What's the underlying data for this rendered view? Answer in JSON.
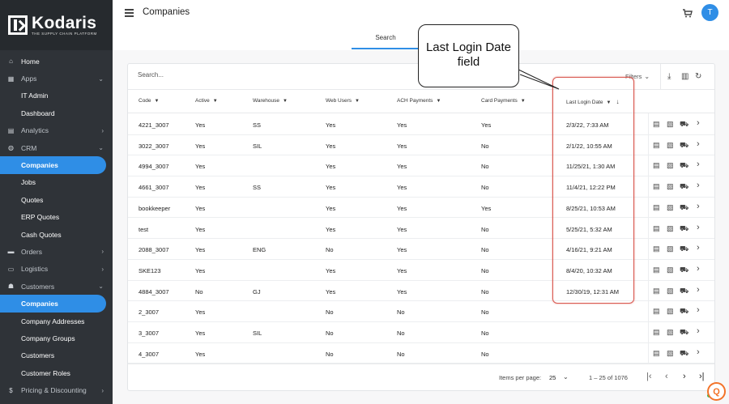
{
  "brand": {
    "name": "Kodaris",
    "tagline": "THE SUPPLY CHAIN PLATFORM"
  },
  "sidebar": {
    "items": [
      {
        "label": "Home",
        "icon": "home-icon",
        "kind": "top",
        "chevron": ""
      },
      {
        "label": "Apps",
        "icon": "grid-icon",
        "kind": "top",
        "chevron": "⌄"
      },
      {
        "label": "IT Admin",
        "icon": "",
        "kind": "sub",
        "chevron": ""
      },
      {
        "label": "Dashboard",
        "icon": "",
        "kind": "sub",
        "chevron": ""
      },
      {
        "label": "Analytics",
        "icon": "chart-icon",
        "kind": "top",
        "chevron": "›"
      },
      {
        "label": "CRM",
        "icon": "crm-icon",
        "kind": "top",
        "chevron": "⌄"
      },
      {
        "label": "Companies",
        "icon": "",
        "kind": "sub active",
        "chevron": ""
      },
      {
        "label": "Jobs",
        "icon": "",
        "kind": "sub",
        "chevron": ""
      },
      {
        "label": "Quotes",
        "icon": "",
        "kind": "sub",
        "chevron": ""
      },
      {
        "label": "ERP Quotes",
        "icon": "",
        "kind": "sub",
        "chevron": ""
      },
      {
        "label": "Cash Quotes",
        "icon": "",
        "kind": "sub",
        "chevron": ""
      },
      {
        "label": "Orders",
        "icon": "truck-icon",
        "kind": "top",
        "chevron": "›"
      },
      {
        "label": "Logistics",
        "icon": "box-icon",
        "kind": "top",
        "chevron": "›"
      },
      {
        "label": "Customers",
        "icon": "people-icon",
        "kind": "top",
        "chevron": "⌄"
      },
      {
        "label": "Companies",
        "icon": "",
        "kind": "sub active",
        "chevron": ""
      },
      {
        "label": "Company Addresses",
        "icon": "",
        "kind": "sub",
        "chevron": ""
      },
      {
        "label": "Company Groups",
        "icon": "",
        "kind": "sub",
        "chevron": ""
      },
      {
        "label": "Customers",
        "icon": "",
        "kind": "sub",
        "chevron": ""
      },
      {
        "label": "Customer Roles",
        "icon": "",
        "kind": "sub",
        "chevron": ""
      },
      {
        "label": "Pricing & Discounting",
        "icon": "dollar-icon",
        "kind": "top",
        "chevron": "›"
      }
    ]
  },
  "header": {
    "title": "Companies",
    "avatar_initial": "T",
    "tab": "Search"
  },
  "toolbar": {
    "search_placeholder": "Search...",
    "filters_label": "Filters"
  },
  "table": {
    "columns": [
      "Code",
      "Active",
      "Warehouse",
      "Web Users",
      "ACH Payments",
      "Card Payments",
      "Last Login Date"
    ],
    "rows": [
      [
        "4221_3007",
        "Yes",
        "SS",
        "Yes",
        "Yes",
        "Yes",
        "2/3/22, 7:33 AM"
      ],
      [
        "3022_3007",
        "Yes",
        "SIL",
        "Yes",
        "Yes",
        "No",
        "2/1/22, 10:55 AM"
      ],
      [
        "4994_3007",
        "Yes",
        "",
        "Yes",
        "Yes",
        "No",
        "11/25/21, 1:30 AM"
      ],
      [
        "4661_3007",
        "Yes",
        "SS",
        "Yes",
        "Yes",
        "No",
        "11/4/21, 12:22 PM"
      ],
      [
        "bookkeeper",
        "Yes",
        "",
        "Yes",
        "Yes",
        "Yes",
        "8/25/21, 10:53 AM"
      ],
      [
        "test",
        "Yes",
        "",
        "Yes",
        "Yes",
        "No",
        "5/25/21, 5:32 AM"
      ],
      [
        "2088_3007",
        "Yes",
        "ENG",
        "No",
        "Yes",
        "No",
        "4/16/21, 9:21 AM"
      ],
      [
        "SKE123",
        "Yes",
        "",
        "Yes",
        "Yes",
        "No",
        "8/4/20, 10:32 AM"
      ],
      [
        "4884_3007",
        "No",
        "GJ",
        "Yes",
        "Yes",
        "No",
        "12/30/19, 12:31 AM"
      ],
      [
        "2_3007",
        "Yes",
        "",
        "No",
        "No",
        "No",
        ""
      ],
      [
        "3_3007",
        "Yes",
        "SIL",
        "No",
        "No",
        "No",
        ""
      ],
      [
        "4_3007",
        "Yes",
        "",
        "No",
        "No",
        "No",
        ""
      ]
    ]
  },
  "footer": {
    "items_per_page_label": "Items per page:",
    "items_per_page": "25",
    "range": "1 – 25 of 1076"
  },
  "annotation": {
    "text": "Last Login Date field"
  }
}
